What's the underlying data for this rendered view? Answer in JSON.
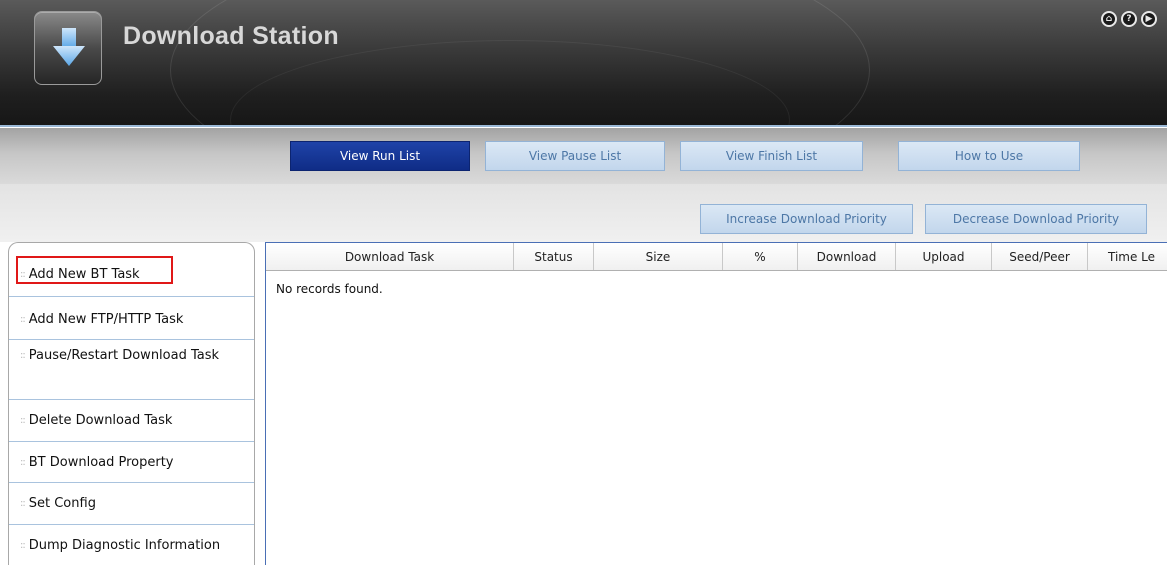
{
  "app": {
    "title": "Download Station",
    "top_icons": [
      {
        "name": "home-icon",
        "glyph": "⌂"
      },
      {
        "name": "help-icon",
        "glyph": "?"
      },
      {
        "name": "next-icon",
        "glyph": "▶"
      }
    ]
  },
  "nav": {
    "view_run_list": "View Run List",
    "view_pause_list": "View Pause List",
    "view_finish_list": "View Finish List",
    "how_to_use": "How to Use",
    "active": "view_run_list"
  },
  "priority": {
    "increase": "Increase Download Priority",
    "decrease": "Decrease Download Priority"
  },
  "sidebar": {
    "items": [
      {
        "label": "Add New BT Task",
        "highlighted": true
      },
      {
        "label": "Add New FTP/HTTP Task"
      },
      {
        "label": "Pause/Restart Download Task"
      },
      {
        "label": "Delete Download Task"
      },
      {
        "label": "BT Download Property"
      },
      {
        "label": "Set Config"
      },
      {
        "label": "Dump Diagnostic Information"
      }
    ]
  },
  "table": {
    "columns": [
      "Download Task",
      "Status",
      "Size",
      "%",
      "Download",
      "Upload",
      "Seed/Peer",
      "Time Le"
    ],
    "empty_message": "No records found."
  },
  "colors": {
    "active_button": "#0f2c86",
    "inactive_button_text": "#4d77a6",
    "highlight_box": "#e01818",
    "header_accent": "#9ab8d6"
  }
}
